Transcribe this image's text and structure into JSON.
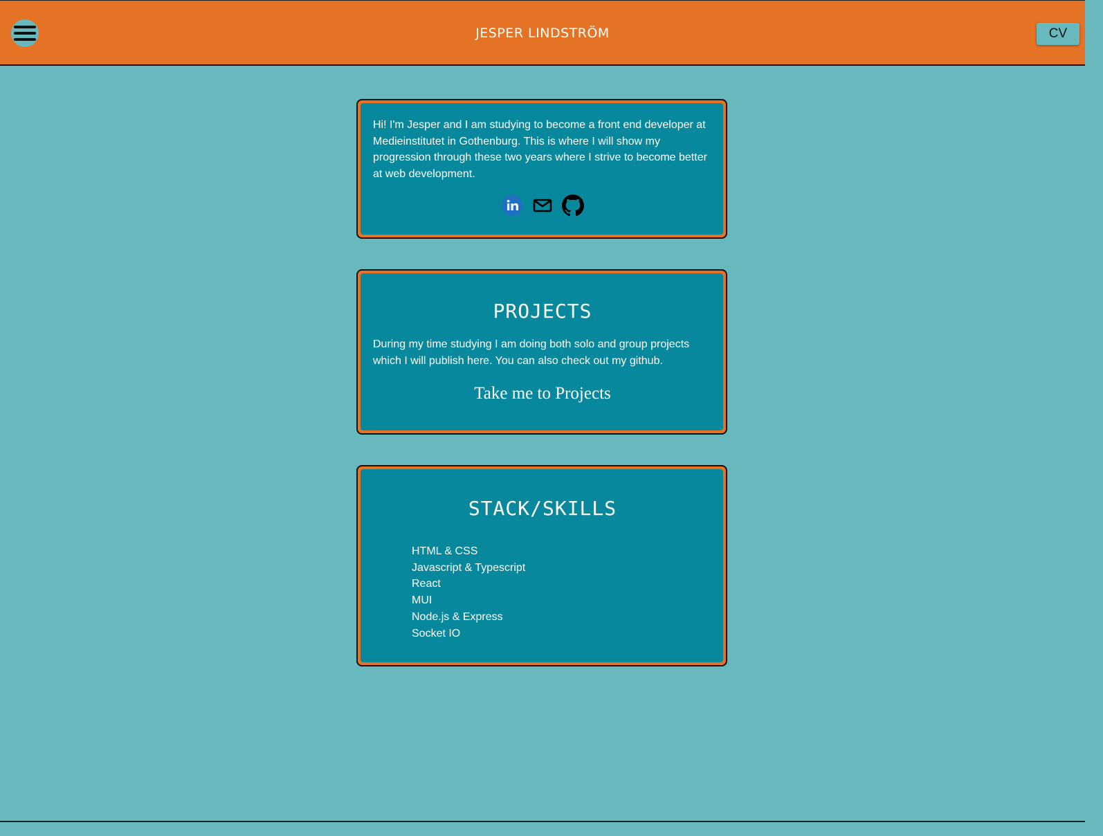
{
  "header": {
    "title": "JESPER LINDSTRÖM",
    "cv_label": "CV",
    "menu_icon": "hamburger-menu-icon"
  },
  "about": {
    "text": "Hi! I'm Jesper and I am studying to become a front end developer at Medieinstitutet in Gothenburg. This is where I will show my progression through these two years where I strive to become better at web development.",
    "social_icons": [
      "linkedin-icon",
      "mail-icon",
      "github-icon"
    ]
  },
  "projects": {
    "title": "PROJECTS",
    "text": "During my time studying I am doing both solo and group projects which I will publish here. You can also check out my github.",
    "link_label": "Take me to Projects"
  },
  "skills": {
    "title": "STACK/SKILLS",
    "items": [
      "HTML & CSS",
      "Javascript & Typescript",
      "React",
      "MUI",
      "Node.js & Express",
      "Socket IO"
    ]
  },
  "colors": {
    "header_bg": "#e57325",
    "page_bg": "#67b9be",
    "card_bg": "#07889c",
    "card_border": "#e57325",
    "linkedin": "#0a66c2"
  }
}
